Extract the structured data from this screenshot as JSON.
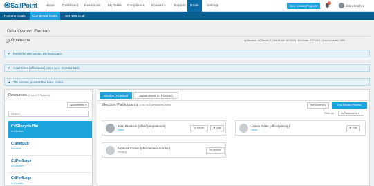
{
  "app": {
    "logo": "SailPoint",
    "nav": [
      "Home",
      "Dashboard",
      "Resources",
      "My Tasks",
      "Compliance",
      "Forensics",
      "Reports",
      "Goals",
      "Settings"
    ],
    "active_nav": "Goals",
    "access_button": "New Access Request",
    "notification_count": "2",
    "user_name": "John Smith",
    "icons": [
      "bell-icon",
      "user-avatar"
    ]
  },
  "subnav": [
    "Running Goals",
    "Completed Goals",
    "Set New Goal"
  ],
  "active_subnav": "Completed Goals",
  "page": {
    "title": "Data Owners Election",
    "goal_name": "Goalname",
    "meta": "Application: ADServer 2 | Start Date: 5/7/2019 | End Date: 6/7/2019 | Goal Achieved: 26%"
  },
  "alerts": [
    {
      "icon": "check-icon",
      "text": "Reminder was sent to the participant."
    },
    {
      "icon": "check-icon",
      "text": "Axiati Chen (office\\aviat) votes were reverted back."
    },
    {
      "icon": "warning-icon",
      "text": "The election process has been ended."
    }
  ],
  "resources": {
    "title": "Resources",
    "subtitle": "(1 out of 3 Finished)",
    "filter_label": "Appointment",
    "search_placeholder": "Search",
    "items": [
      {
        "name": "C:\\$Recycle.Bin",
        "status": "In Election"
      },
      {
        "name": "C:\\inetpub",
        "status": "Finished"
      },
      {
        "name": "C:\\PerfLogs",
        "status": "In Election"
      },
      {
        "name": "C:\\PerfLogs",
        "status": "In Election"
      }
    ]
  },
  "tabs": [
    "Election (Finished)",
    "Appointment (In Process)"
  ],
  "election": {
    "title": "Election Participants",
    "subtitle": "(2 out of 3 participants voted)",
    "summary_button": "See Summary",
    "end_button": "End Election Process",
    "filter_label": "Filter by:",
    "filter_value": "All Participants",
    "participants": [
      {
        "name": "Juan Peterson (office\\juanpeterson)",
        "status": "Voted",
        "actions": [
          "Revert",
          "Vote"
        ]
      },
      {
        "name": "James Petter (office\\jamesp)",
        "status": "Voted",
        "actions": [
          "Vote"
        ]
      },
      {
        "name": "Amanda Conlon (office\\amandaconlon)",
        "status": "Pending",
        "actions": [
          "Remind"
        ]
      }
    ]
  }
}
